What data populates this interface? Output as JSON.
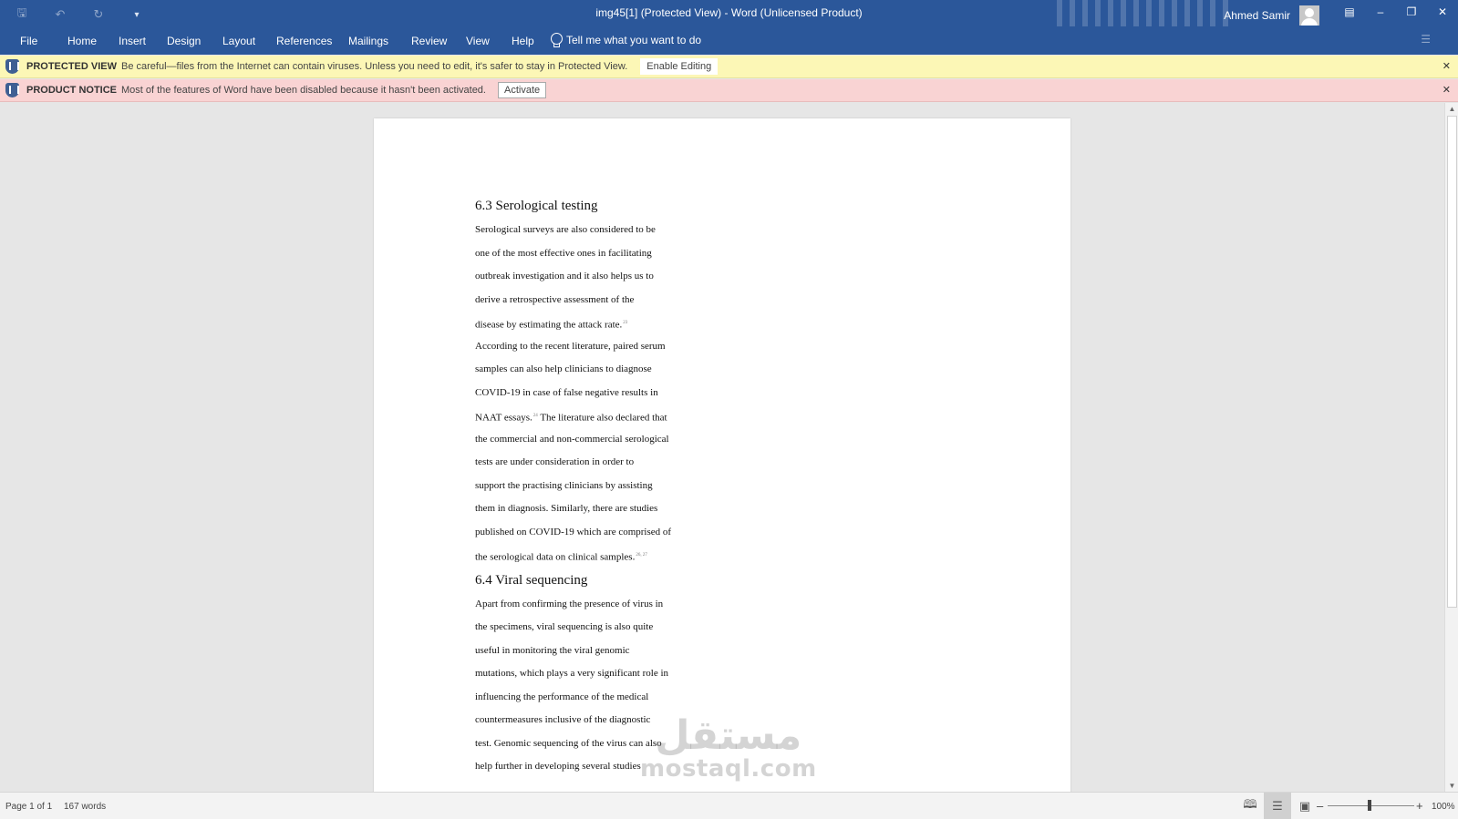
{
  "window": {
    "title": "img45[1] (Protected View)  -  Word (Unlicensed Product)",
    "user_name": "Ahmed Samir",
    "qat_icons": [
      "save-icon",
      "undo-icon",
      "redo-icon",
      "customize-qat-icon"
    ]
  },
  "ribbon": {
    "tabs": [
      "File",
      "Home",
      "Insert",
      "Design",
      "Layout",
      "References",
      "Mailings",
      "Review",
      "View",
      "Help"
    ],
    "tell_me": "Tell me what you want to do"
  },
  "protected_bar": {
    "title": "PROTECTED VIEW",
    "message": "Be careful—files from the Internet can contain viruses. Unless you need to edit, it's safer to stay in Protected View.",
    "button": "Enable Editing",
    "color": "#fcf7b6"
  },
  "product_bar": {
    "title": "PRODUCT NOTICE",
    "message": "Most of the features of Word have been disabled because it hasn't been activated.",
    "button": "Activate",
    "color": "#f9d3d3"
  },
  "document": {
    "heading1": "6.3 Serological testing",
    "section1": [
      "Serological surveys are also considered to be",
      "one of the most effective ones in facilitating",
      "outbreak investigation and it also helps us to",
      "derive a retrospective assessment of the",
      "disease by estimating the attack rate.",
      "According to the recent literature, paired serum",
      "samples can also help clinicians to diagnose",
      "COVID-19 in case of false negative results in",
      "NAAT essays.",
      "The literature also declared that",
      "the commercial and non-commercial serological",
      "tests are under consideration in order to",
      "support the practising clinicians by assisting",
      "them in diagnosis. Similarly, there are studies",
      "published on COVID-19 which are comprised of",
      "the serological data on clinical samples."
    ],
    "heading2": "6.4 Viral sequencing",
    "section2": [
      "Apart from confirming the presence of virus in",
      "the specimens, viral sequencing is also quite",
      "useful in monitoring the viral genomic",
      "mutations, which plays a very significant role in",
      "influencing the performance of the medical",
      "countermeasures inclusive of the diagnostic",
      "test. Genomic sequencing of the virus can also",
      "help further in developing several studies"
    ]
  },
  "watermark": {
    "arabic": "مستقل",
    "latin": "mostaql.com"
  },
  "status": {
    "page": "Page 1 of 1",
    "words": "167 words",
    "zoom": "100%",
    "zoom_level_percent": 100
  }
}
